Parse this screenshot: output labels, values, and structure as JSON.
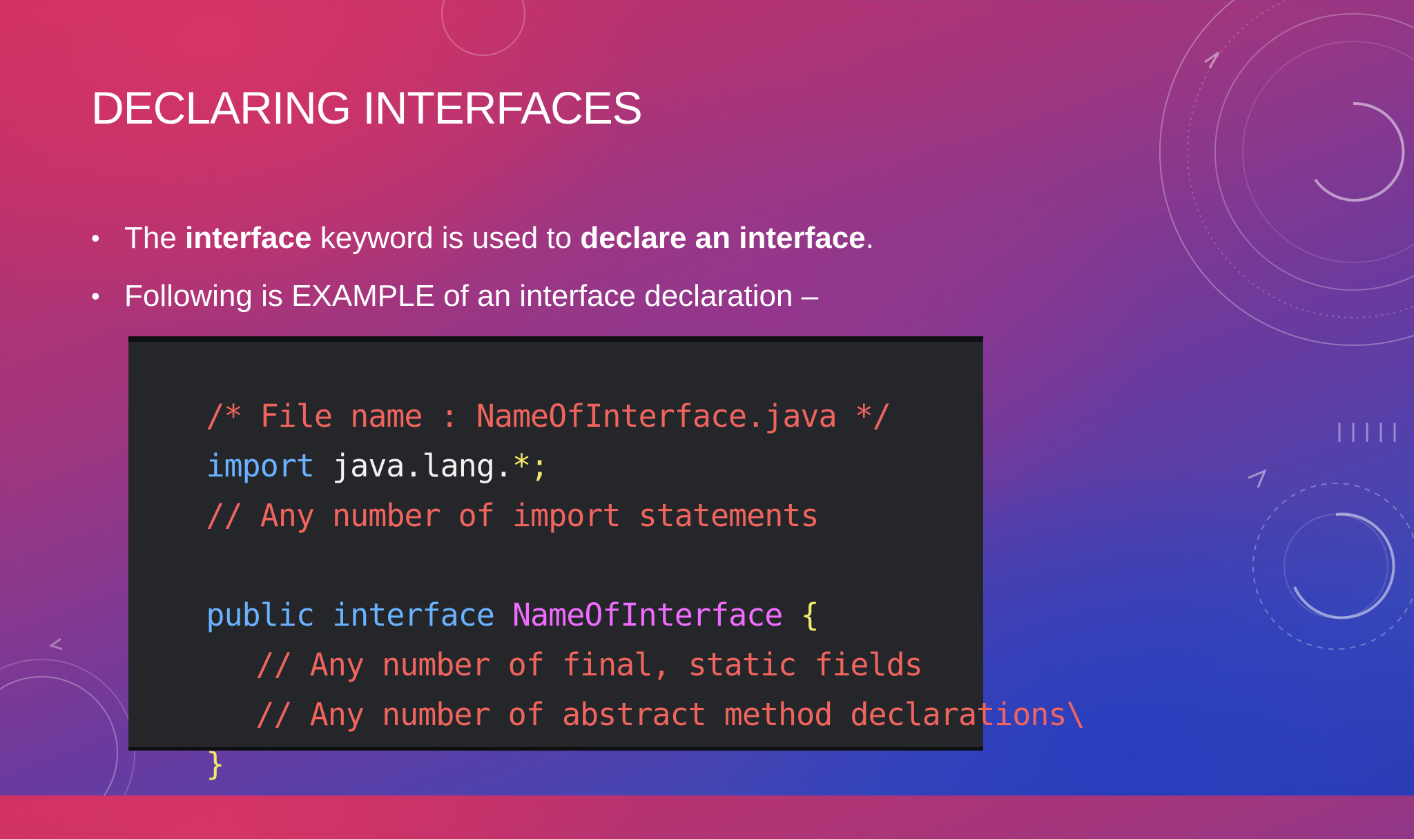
{
  "slide": {
    "title": "DECLARING INTERFACES",
    "bullets": [
      {
        "parts": [
          "The ",
          "interface",
          " keyword is used to ",
          "declare an interface",
          "."
        ]
      },
      {
        "text": "Following is EXAMPLE of an interface declaration –"
      }
    ]
  },
  "code": {
    "lines": [
      {
        "comment": "/* File name : NameOfInterface.java */"
      },
      {
        "kw": "import",
        "rest": " java.lang.",
        "sym": "*;"
      },
      {
        "comment": "// Any number of import statements"
      },
      {
        "kw1": "public",
        "kw2": "interface",
        "type": "NameOfInterface",
        "brace": "{"
      },
      {
        "comment": "// Any number of final, static fields"
      },
      {
        "comment": "// Any number of abstract method declarations\\"
      },
      {
        "brace": "}"
      }
    ]
  },
  "colors": {
    "code_background": "#25262a",
    "comment": "#f0645e",
    "keyword": "#6ab2ff",
    "type": "#f06cff",
    "brace": "#f3e86a"
  }
}
